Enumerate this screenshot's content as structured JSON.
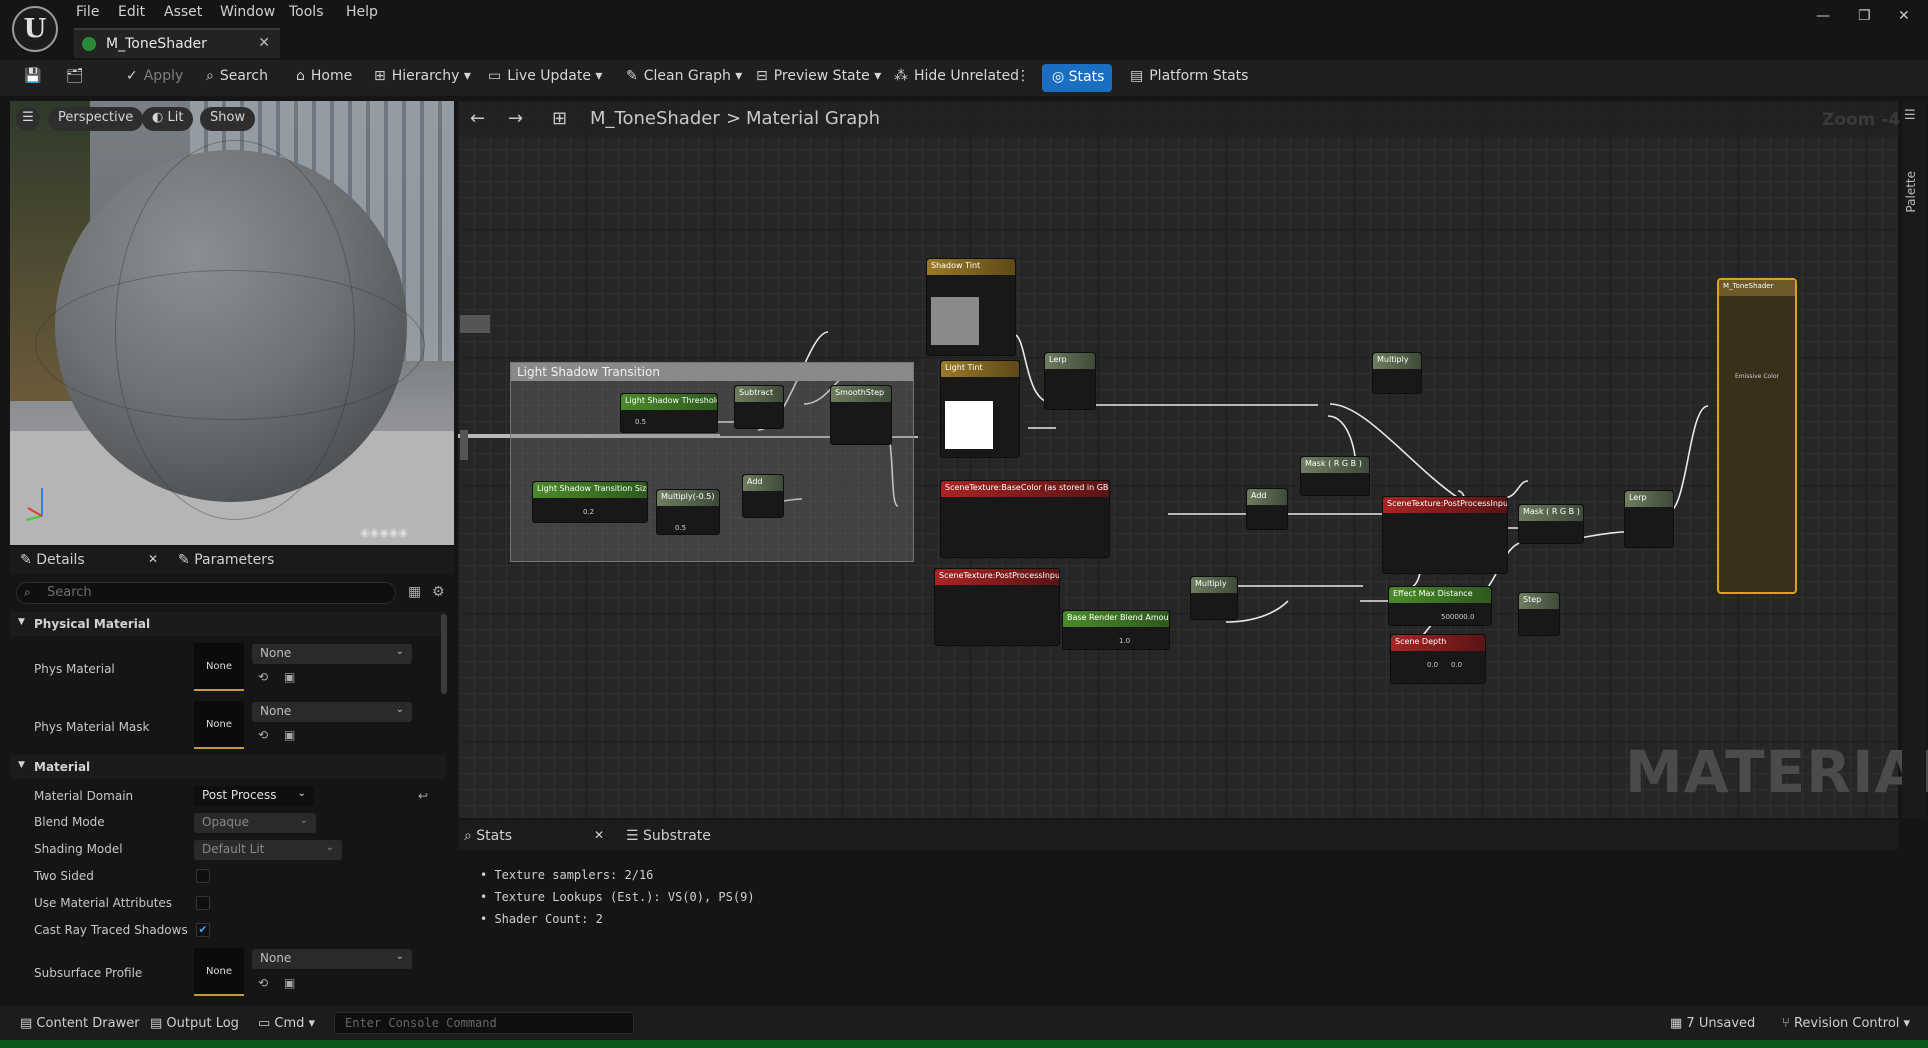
{
  "menu": {
    "file": "File",
    "edit": "Edit",
    "asset": "Asset",
    "window": "Window",
    "tools": "Tools",
    "help": "Help"
  },
  "doc_tab": {
    "title": "M_ToneShader"
  },
  "toolbar": {
    "apply": "Apply",
    "search": "Search",
    "home": "Home",
    "hierarchy": "Hierarchy",
    "live_update": "Live Update",
    "clean_graph": "Clean Graph",
    "preview_state": "Preview State",
    "hide_unrelated": "Hide Unrelated",
    "stats": "Stats",
    "platform_stats": "Platform Stats"
  },
  "viewport": {
    "perspective": "Perspective",
    "lit": "Lit",
    "show": "Show"
  },
  "details": {
    "tab_details": "Details",
    "tab_parameters": "Parameters",
    "search_placeholder": "Search",
    "sections": {
      "physical_material": "Physical Material",
      "material": "Material"
    },
    "phys_material": {
      "label": "Phys Material",
      "thumb": "None",
      "value": "None"
    },
    "phys_material_mask": {
      "label": "Phys Material Mask",
      "thumb": "None",
      "value": "None"
    },
    "material_domain": {
      "label": "Material Domain",
      "value": "Post Process"
    },
    "blend_mode": {
      "label": "Blend Mode",
      "value": "Opaque"
    },
    "shading_model": {
      "label": "Shading Model",
      "value": "Default Lit"
    },
    "two_sided": {
      "label": "Two Sided",
      "checked": false
    },
    "use_material_attributes": {
      "label": "Use Material Attributes",
      "checked": false
    },
    "cast_ray_traced_shadows": {
      "label": "Cast Ray Traced Shadows",
      "checked": true
    },
    "subsurface_profile": {
      "label": "Subsurface Profile",
      "thumb": "None",
      "value": "None"
    }
  },
  "graph": {
    "breadcrumb_root": "M_ToneShader",
    "breadcrumb_sep": ">",
    "breadcrumb_leaf": "Material Graph",
    "zoom": "Zoom -4",
    "watermark": "MATERIAL",
    "palette": "Palette",
    "comment_title": "Light Shadow Transition",
    "nodes": {
      "light_shadow_threshold": "Light Shadow Threshold",
      "lst_value": "0.5",
      "subtract": "Subtract",
      "smoothstep": "SmoothStep",
      "add_small": "Add",
      "light_shadow_transition_size": "Light Shadow Transition Size",
      "lsts_value": "0.2",
      "multiply_neg": "Multiply(-0.5)",
      "multiply_neg_b": "0.5",
      "shadow_tint": "Shadow Tint",
      "light_tint": "Light Tint",
      "lerp1": "Lerp",
      "multiply_top": "Multiply",
      "mask_rgb1": "Mask ( R G B )",
      "add_mid": "Add",
      "scene_basecolor": "SceneTexture:BaseColor (as stored in GBuffer)",
      "scene_pp1": "SceneTexture:PostProcessInput0",
      "multiply_mid": "Multiply",
      "base_render_blend": "Base Render Blend Amount",
      "brb_value": "1.0",
      "scene_pp2": "SceneTexture:PostProcessInput0",
      "mask_rgb2": "Mask ( R G B )",
      "lerp2": "Lerp",
      "effect_max_distance": "Effect Max Distance",
      "emd_value": "500000.0",
      "step": "Step",
      "scene_depth": "Scene Depth",
      "sd_x": "0.0",
      "sd_y": "0.0",
      "output": "M_ToneShader",
      "emissive": "Emissive Color"
    }
  },
  "bottom": {
    "tab_stats": "Stats",
    "tab_substrate": "Substrate",
    "lines": [
      "Texture samplers: 2/16",
      "Texture Lookups (Est.): VS(0), PS(9)",
      "Shader Count: 2"
    ]
  },
  "statusbar": {
    "content_drawer": "Content Drawer",
    "output_log": "Output Log",
    "cmd": "Cmd",
    "console_placeholder": "Enter Console Command",
    "unsaved": "7 Unsaved",
    "revision": "Revision Control"
  },
  "colors": {
    "accent": "#1a6fc2",
    "output_border": "#e0a020"
  }
}
